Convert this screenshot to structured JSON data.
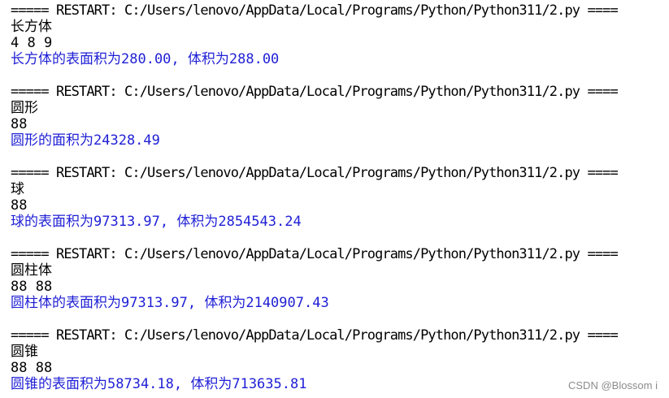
{
  "colors": {
    "background": "#ffffff",
    "input_text": "#000000",
    "program_output": "#1f1fd6",
    "watermark": "#8c8c8c"
  },
  "shell_lines": [
    {
      "kind": "restart",
      "text": "===== RESTART: C:/Users/lenovo/AppData/Local/Programs/Python/Python311/2.py ===="
    },
    {
      "kind": "input",
      "text": "长方体"
    },
    {
      "kind": "input",
      "text": "4 8 9"
    },
    {
      "kind": "output",
      "text": "长方体的表面积为280.00, 体积为288.00"
    },
    {
      "kind": "blank",
      "text": ""
    },
    {
      "kind": "restart",
      "text": "===== RESTART: C:/Users/lenovo/AppData/Local/Programs/Python/Python311/2.py ===="
    },
    {
      "kind": "input",
      "text": "圆形"
    },
    {
      "kind": "input",
      "text": "88"
    },
    {
      "kind": "output",
      "text": "圆形的面积为24328.49"
    },
    {
      "kind": "blank",
      "text": ""
    },
    {
      "kind": "restart",
      "text": "===== RESTART: C:/Users/lenovo/AppData/Local/Programs/Python/Python311/2.py ===="
    },
    {
      "kind": "input",
      "text": "球"
    },
    {
      "kind": "input",
      "text": "88"
    },
    {
      "kind": "output",
      "text": "球的表面积为97313.97, 体积为2854543.24"
    },
    {
      "kind": "blank",
      "text": ""
    },
    {
      "kind": "restart",
      "text": "===== RESTART: C:/Users/lenovo/AppData/Local/Programs/Python/Python311/2.py ===="
    },
    {
      "kind": "input",
      "text": "圆柱体"
    },
    {
      "kind": "input",
      "text": "88 88"
    },
    {
      "kind": "output",
      "text": "圆柱体的表面积为97313.97, 体积为2140907.43"
    },
    {
      "kind": "blank",
      "text": ""
    },
    {
      "kind": "restart",
      "text": "===== RESTART: C:/Users/lenovo/AppData/Local/Programs/Python/Python311/2.py ===="
    },
    {
      "kind": "input",
      "text": "圆锥"
    },
    {
      "kind": "input",
      "text": "88 88"
    },
    {
      "kind": "output",
      "text": "圆锥的表面积为58734.18, 体积为713635.81"
    }
  ],
  "watermark": "CSDN @Blossom i"
}
